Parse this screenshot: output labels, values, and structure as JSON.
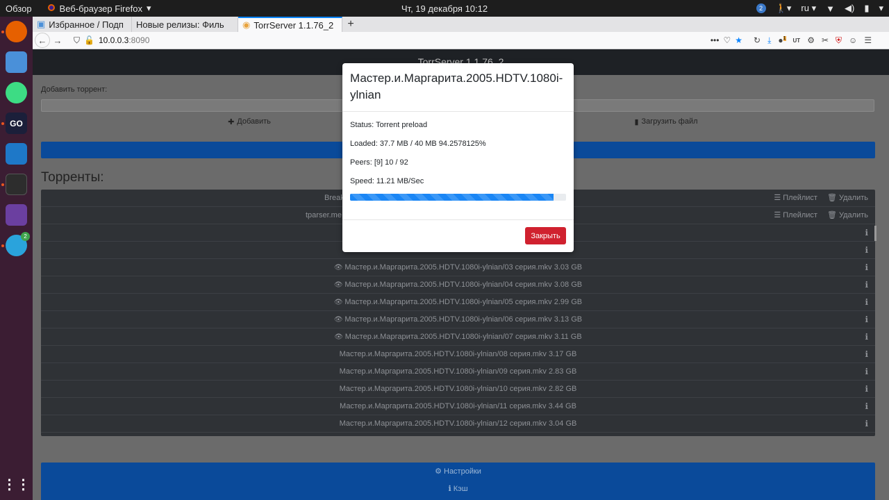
{
  "topbar": {
    "activities": "Обзор",
    "app_name": "Веб-браузер Firefox",
    "clock": "Чт, 19 декабря  10:12",
    "notif_count": "2",
    "lang": "ru"
  },
  "dock": {
    "telegram_badge": "2",
    "go_label": "GO"
  },
  "tabs": [
    {
      "label": "Избранное / Подп"
    },
    {
      "label": "Новые релизы: Филь"
    },
    {
      "label": "TorrServer 1.1.76_2"
    }
  ],
  "url": {
    "host": "10.0.0.3",
    "port": ":8090"
  },
  "extensions": {
    "badge": "1",
    "ut_label": "UT"
  },
  "page": {
    "header": "TorrServer 1.1.76_2",
    "add_label": "Добавить торрент:",
    "add_button": "Добавить",
    "upload_button": "Загрузить файл",
    "torrents_title": "Торренты:",
    "playlist": "Плейлист",
    "delete": "Удалить",
    "settings": "Настройки",
    "cache": "Кэш",
    "torrents": [
      {
        "name": "Break"
      },
      {
        "name": "tparser.me"
      }
    ],
    "files": [
      {
        "name": "Мастер.и.Маргарита.2005.HDTV.1080i-ylnian/03 серия.mkv 3.03 GB",
        "viewed": true
      },
      {
        "name": "Мастер.и.Маргарита.2005.HDTV.1080i-ylnian/04 серия.mkv 3.08 GB",
        "viewed": true
      },
      {
        "name": "Мастер.и.Маргарита.2005.HDTV.1080i-ylnian/05 серия.mkv 2.99 GB",
        "viewed": true
      },
      {
        "name": "Мастер.и.Маргарита.2005.HDTV.1080i-ylnian/06 серия.mkv 3.13 GB",
        "viewed": true
      },
      {
        "name": "Мастер.и.Маргарита.2005.HDTV.1080i-ylnian/07 серия.mkv 3.11 GB",
        "viewed": true
      },
      {
        "name": "Мастер.и.Маргарита.2005.HDTV.1080i-ylnian/08 серия.mkv 3.17 GB",
        "viewed": false
      },
      {
        "name": "Мастер.и.Маргарита.2005.HDTV.1080i-ylnian/09 серия.mkv 2.83 GB",
        "viewed": false
      },
      {
        "name": "Мастер.и.Маргарита.2005.HDTV.1080i-ylnian/10 серия.mkv 2.82 GB",
        "viewed": false
      },
      {
        "name": "Мастер.и.Маргарита.2005.HDTV.1080i-ylnian/11 серия.mkv 3.44 GB",
        "viewed": false
      },
      {
        "name": "Мастер.и.Маргарита.2005.HDTV.1080i-ylnian/12 серия.mkv 3.04 GB",
        "viewed": false
      }
    ]
  },
  "modal": {
    "title": "Мастер.и.Маргарита.2005.HDTV.1080i-ylnian",
    "status": "Status: Torrent preload",
    "loaded": "Loaded: 37.7 MB / 40 MB 94.2578125%",
    "peers": "Peers: [9] 10 / 92",
    "speed": "Speed: 11.21 MB/Sec",
    "progress_percent": 94.2578125,
    "close": "Закрыть"
  }
}
